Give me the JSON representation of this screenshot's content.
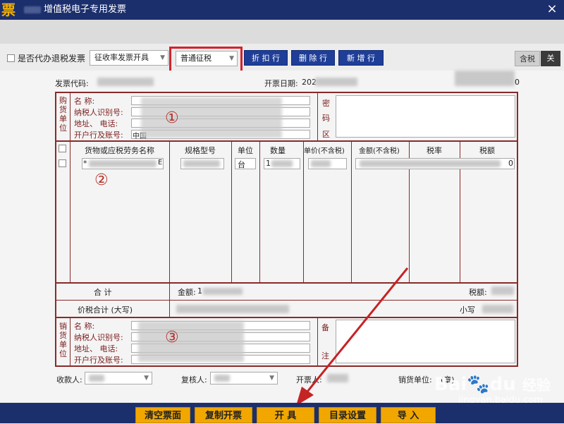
{
  "window": {
    "app_icon": "票",
    "title": "增值税电子专用发票",
    "close": "×"
  },
  "toolbar": {
    "agent_refund_label": "是否代办退税发票",
    "levy_select": "征收率发票开具",
    "taxation_select": "普通征税",
    "discount_row": "折 扣 行",
    "delete_row": "删 除 行",
    "add_row": "新 增 行",
    "tax_included": "含税",
    "close_tab": "关"
  },
  "header": {
    "invoice_code_label": "发票代码:",
    "invoice_date_label": "开票日期:",
    "invoice_date_visible": "202",
    "right_value_tail": "0"
  },
  "buyer": {
    "side_label": [
      "购",
      "货",
      "单",
      "位"
    ],
    "name_label": "名          称:",
    "taxid_label": "纳税人识别号:",
    "address_label": "地址、    电话:",
    "bank_label": "开户行及账号:",
    "bank_prefix": "中国",
    "secret_labels": [
      "密",
      "码",
      "区"
    ]
  },
  "goods": {
    "headers": [
      "货物或应税劳务名称",
      "规格型号",
      "单位",
      "数量",
      "单价(不含税)",
      "金额(不含税)",
      "税率",
      "税额"
    ],
    "row": {
      "name_prefix": "*",
      "name_suffix": "E",
      "unit": "台",
      "quantity_prefix": "1",
      "tax_amount_suffix": "0"
    }
  },
  "totals": {
    "sum_label": "合       计",
    "amount_label": "金额:",
    "amount_prefix": "1",
    "tax_label": "税额:",
    "price_tax_label": "价税合计 (大写)",
    "small_label": "小写"
  },
  "seller": {
    "side_label": [
      "销",
      "货",
      "单",
      "位"
    ],
    "name_label": "名          称:",
    "taxid_label": "纳税人识别号:",
    "address_label": "地址、    电话:",
    "bank_label": "开户行及账号:",
    "remark_label": "备",
    "remark_label_2": "注"
  },
  "signers": {
    "payee_label": "收款人:",
    "reviewer_label": "复核人:",
    "issuer_label": "开票人:",
    "seller_unit_label": "销货单位:",
    "seal_label": "(章)"
  },
  "annotations": {
    "circle1": "①",
    "circle2": "②",
    "circle3": "③"
  },
  "footer": {
    "clear": "清空票面",
    "copy": "复制开票",
    "issue": "开 具",
    "catalog": "目录设置",
    "import": "导 入"
  },
  "watermark": {
    "brand": "Bai",
    "paw": "du",
    "jy": "经验",
    "url": "jingyan.baidu.com"
  },
  "colors": {
    "title_bar": "#1c2f6d",
    "blue_button": "#1f3e97",
    "footer_button": "#f1a700",
    "highlight_red": "#d4212b",
    "form_line": "#8a2a2a"
  }
}
